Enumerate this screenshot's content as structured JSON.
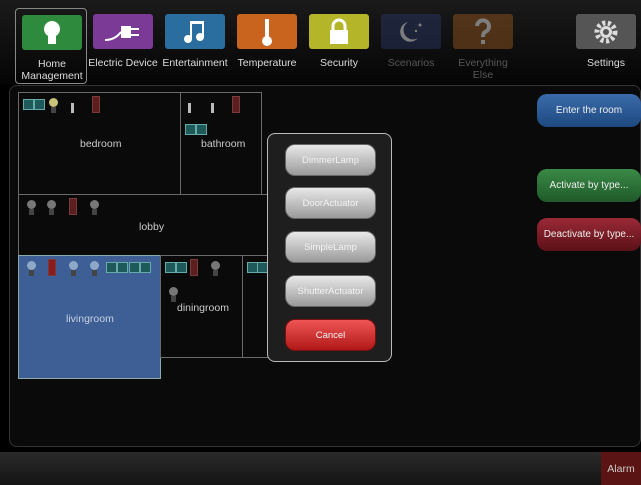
{
  "tabs": [
    {
      "label": "Home Management",
      "icon": "lightbulb-icon",
      "color": "#2e8b3e",
      "state": "active"
    },
    {
      "label": "Electric Device",
      "icon": "plug-icon",
      "color": "#7a3a96",
      "state": "normal"
    },
    {
      "label": "Entertainment",
      "icon": "music-note-icon",
      "color": "#2a6ea0",
      "state": "normal"
    },
    {
      "label": "Temperature",
      "icon": "thermometer-icon",
      "color": "#c8641e",
      "state": "normal"
    },
    {
      "label": "Security",
      "icon": "padlock-icon",
      "color": "#b5b52a",
      "state": "normal"
    },
    {
      "label": "Scenarios",
      "icon": "moon-stars-icon",
      "color": "#2a3a6a",
      "state": "disabled"
    },
    {
      "label": "Everything Else",
      "icon": "question-mark-icon",
      "color": "#9a5a1e",
      "state": "disabled"
    },
    {
      "label": "Settings",
      "icon": "gear-icon",
      "color": "#555555",
      "state": "normal"
    }
  ],
  "rooms": {
    "bedroom": "bedroom",
    "bathroom": "bathroom",
    "lobby": "lobby",
    "livingroom": "livingroom",
    "diningroom": "diningroom"
  },
  "side_buttons": {
    "enter_room": "Enter the room",
    "activate_by_type": "Activate by type...",
    "deactivate_by_type": "Deactivate by type..."
  },
  "popup": {
    "options": [
      "DimmerLamp",
      "DoorActuator",
      "SimpleLamp",
      "ShutterActuator"
    ],
    "cancel": "Cancel"
  },
  "bottom": {
    "alarm": "Alarm"
  },
  "colors": {
    "selected_room": "#3d5f96",
    "enter_room": "#2a5a9a",
    "activate": "#2f7a3a",
    "deactivate": "#8a1c2a"
  }
}
